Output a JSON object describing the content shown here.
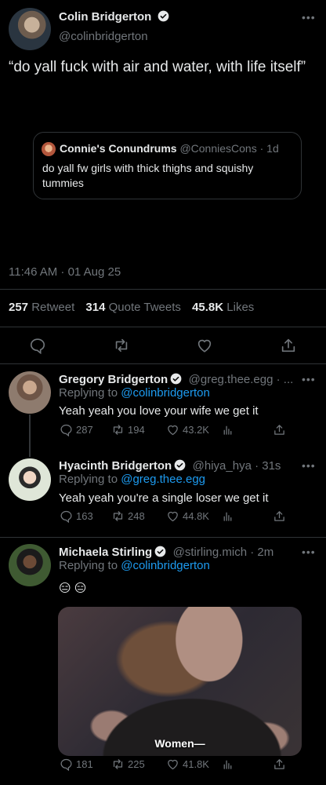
{
  "main_tweet": {
    "author_name": "Colin Bridgerton",
    "handle": "@colinbridgerton",
    "text": "“do yall fuck with air and water, with life itself”",
    "timestamp": "11:46 AM · 01 Aug 25",
    "quote": {
      "author_name": "Connie's Conundrums",
      "handle": "@ConniesCons",
      "time": "· 1d",
      "text": "do yall fw girls with thick thighs and squishy tummies"
    },
    "stats": {
      "retweets": "257",
      "retweet_label": "Retweet",
      "quotes": "314",
      "quotes_label": "Quote Tweets",
      "likes": "45.8K",
      "likes_label": "Likes"
    }
  },
  "replies": [
    {
      "author_name": "Gregory Bridgerton",
      "handle": "@greg.thee.egg · ...",
      "replying_prefix": "Replying to ",
      "replying_to": "@colinbridgerton",
      "text": "Yeah yeah you love your wife we get it",
      "replies": "287",
      "retweets": "194",
      "likes": "43.2K"
    },
    {
      "author_name": "Hyacinth Bridgerton",
      "handle": "@hiya_hya · 31s",
      "replying_prefix": "Replying to ",
      "replying_to": "@greg.thee.egg",
      "text": "Yeah yeah you're a single loser we get it",
      "replies": "163",
      "retweets": "248",
      "likes": "44.8K"
    },
    {
      "author_name": "Michaela Stirling",
      "handle": "@stirling.mich · 2m",
      "replying_prefix": "Replying to ",
      "replying_to": "@colinbridgerton",
      "text": "😑 😑",
      "media_caption": "Women—",
      "replies": "181",
      "retweets": "225",
      "likes": "41.8K"
    }
  ],
  "colors": {
    "accent": "#1d9bf0",
    "muted": "#71767b",
    "divider": "#2f3336",
    "verified": "#e7e9ea"
  },
  "icons": [
    "verified-icon",
    "more-icon",
    "reply-icon",
    "retweet-icon",
    "like-icon",
    "views-icon",
    "share-icon"
  ]
}
